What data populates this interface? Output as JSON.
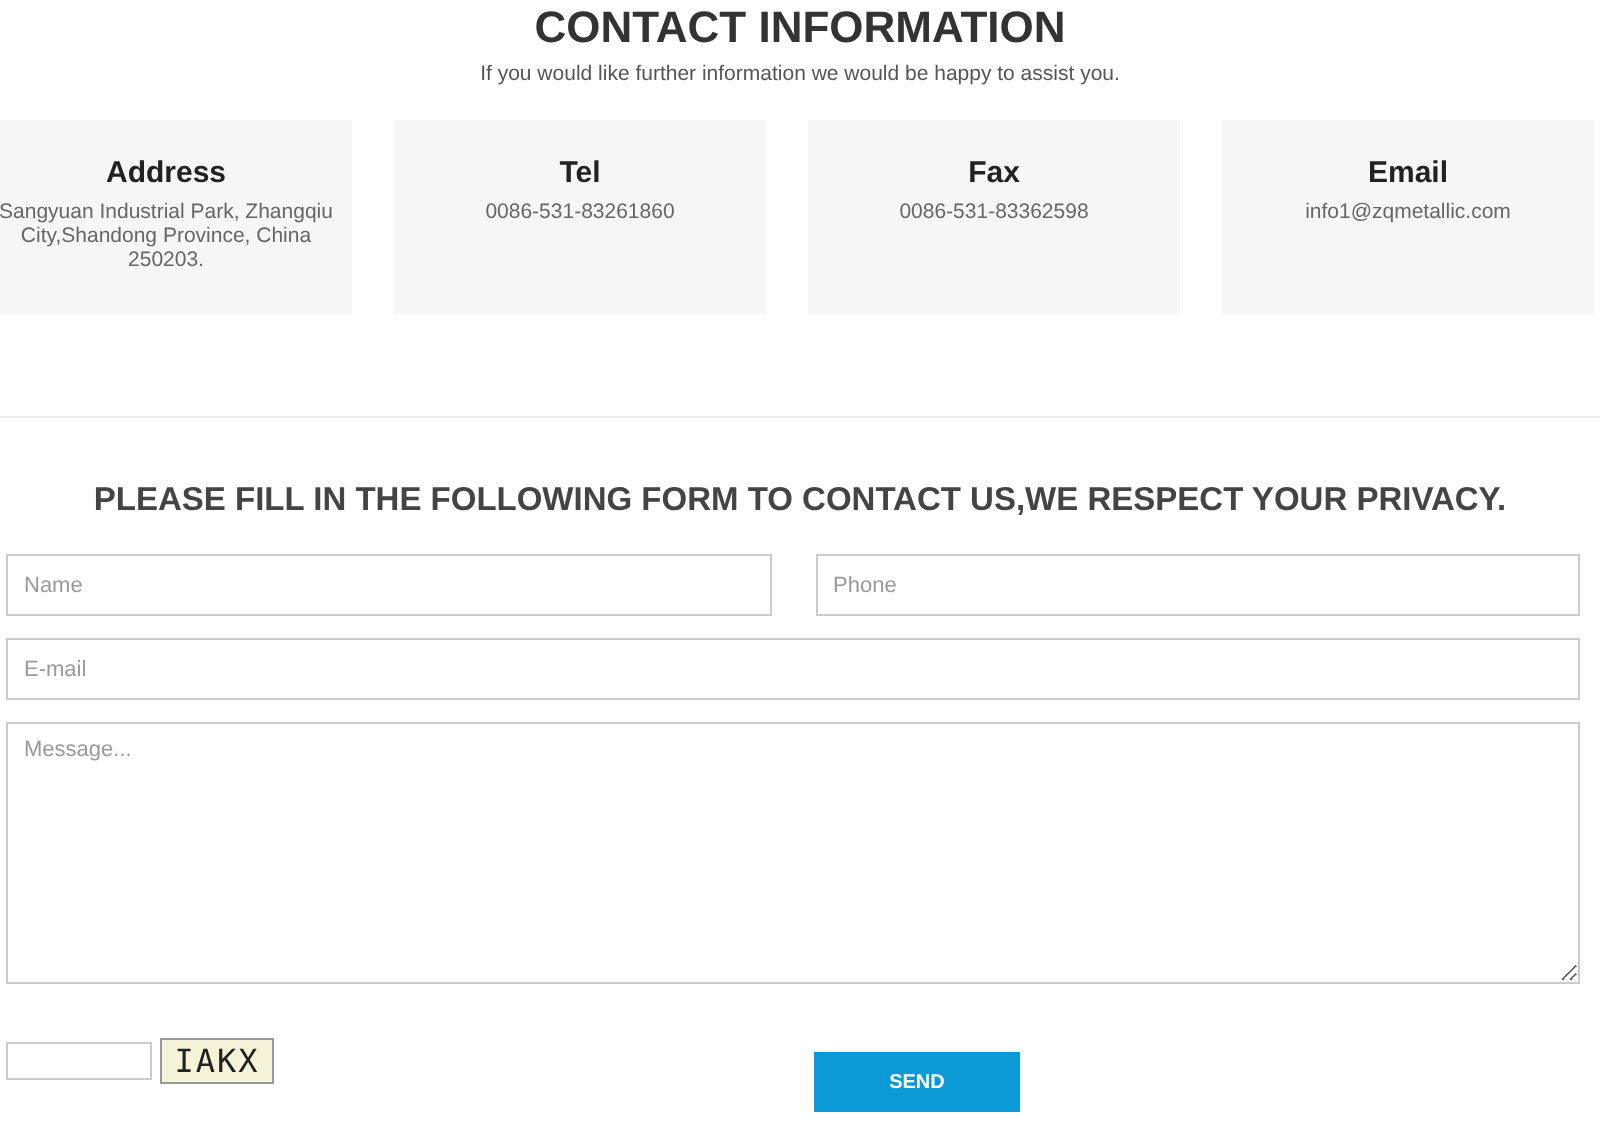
{
  "header": {
    "title": "CONTACT INFORMATION",
    "subtitle": "If you would like further information we would be happy to assist you."
  },
  "cards": [
    {
      "title": "Address",
      "text": "Sangyuan Industrial Park, Zhangqiu City,Shandong Province, China 250203."
    },
    {
      "title": "Tel",
      "text": "0086-531-83261860"
    },
    {
      "title": "Fax",
      "text": "0086-531-83362598"
    },
    {
      "title": "Email",
      "text": "info1@zqmetallic.com"
    }
  ],
  "form": {
    "heading": "PLEASE FILL IN THE FOLLOWING FORM TO CONTACT US,WE RESPECT YOUR PRIVACY.",
    "name": {
      "placeholder": "Name"
    },
    "phone": {
      "placeholder": "Phone"
    },
    "email": {
      "placeholder": "E-mail"
    },
    "message": {
      "placeholder": "Message..."
    },
    "captcha": {
      "code": "IAKX"
    },
    "submit": "SEND"
  }
}
